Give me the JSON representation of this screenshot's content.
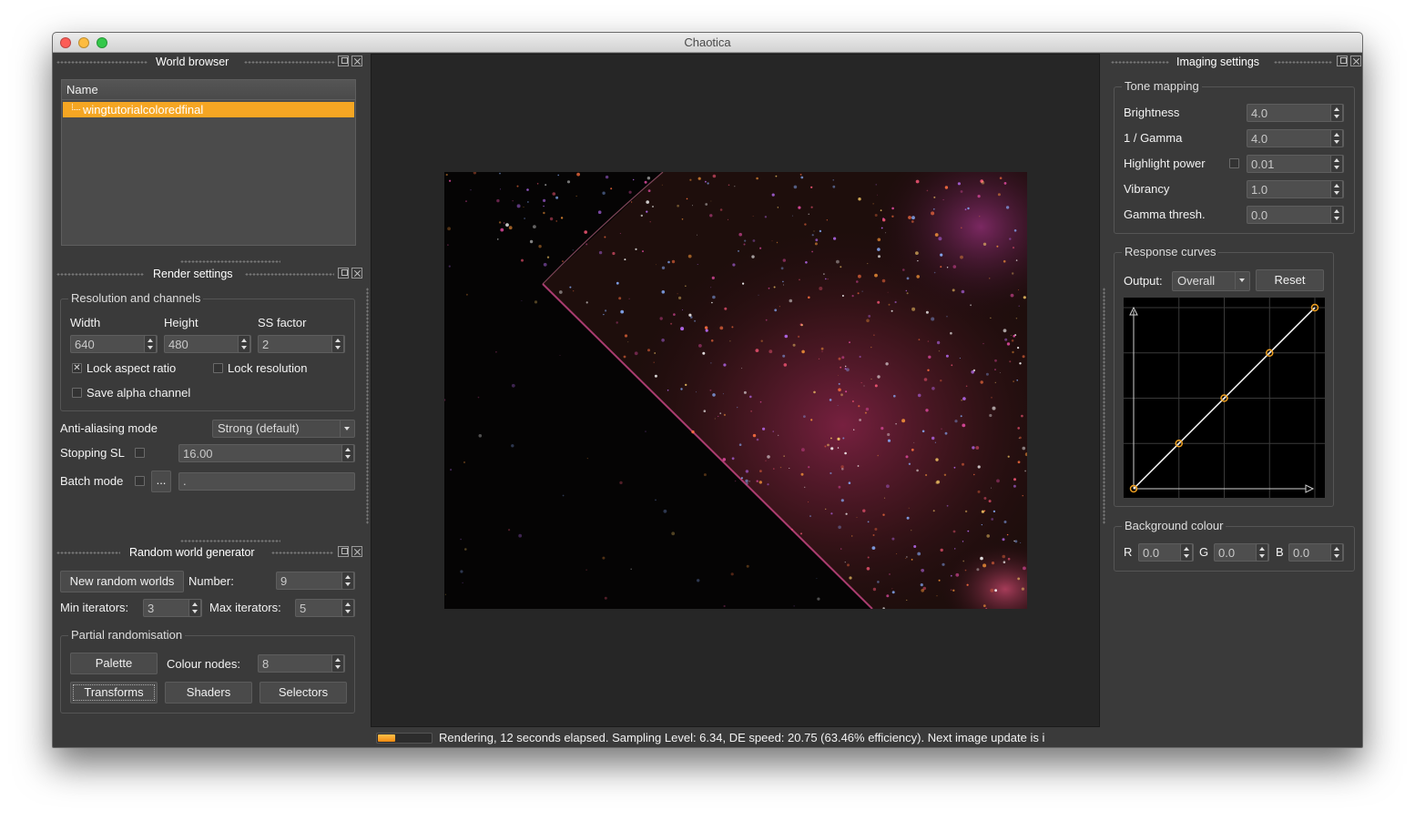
{
  "window": {
    "title": "Chaotica"
  },
  "world_browser": {
    "title": "World browser",
    "column_header": "Name",
    "items": [
      "wingtutorialcoloredfinal"
    ]
  },
  "render_settings": {
    "title": "Render settings",
    "group_title": "Resolution and channels",
    "width_label": "Width",
    "height_label": "Height",
    "ss_label": "SS factor",
    "width_value": "640",
    "height_value": "480",
    "ss_value": "2",
    "lock_aspect_label": "Lock aspect ratio",
    "lock_aspect_checked": true,
    "lock_resolution_label": "Lock resolution",
    "lock_resolution_checked": false,
    "save_alpha_label": "Save alpha channel",
    "save_alpha_checked": false,
    "aa_label": "Anti-aliasing mode",
    "aa_value": "Strong (default)",
    "stopping_label": "Stopping SL",
    "stopping_checked": false,
    "stopping_value": "16.00",
    "batch_label": "Batch mode",
    "batch_checked": false,
    "batch_button": "...",
    "batch_path": "."
  },
  "random_generator": {
    "title": "Random world generator",
    "new_button": "New random worlds",
    "number_label": "Number:",
    "number_value": "9",
    "min_label": "Min iterators:",
    "min_value": "3",
    "max_label": "Max iterators:",
    "max_value": "5",
    "partial_title": "Partial randomisation",
    "palette_button": "Palette",
    "colour_nodes_label": "Colour nodes:",
    "colour_nodes_value": "8",
    "transforms_button": "Transforms",
    "shaders_button": "Shaders",
    "selectors_button": "Selectors"
  },
  "imaging": {
    "title": "Imaging settings",
    "tone_title": "Tone mapping",
    "brightness_label": "Brightness",
    "brightness_value": "4.0",
    "gamma_label": "1 / Gamma",
    "gamma_value": "4.0",
    "highlight_label": "Highlight power",
    "highlight_checked": false,
    "highlight_value": "0.01",
    "vibrancy_label": "Vibrancy",
    "vibrancy_value": "1.0",
    "gamma_thresh_label": "Gamma thresh.",
    "gamma_thresh_value": "0.0",
    "curves_title": "Response curves",
    "output_label": "Output:",
    "output_value": "Overall",
    "reset_button": "Reset",
    "curve_points": [
      [
        0,
        0
      ],
      [
        0.25,
        0.25
      ],
      [
        0.5,
        0.5
      ],
      [
        0.75,
        0.75
      ],
      [
        1,
        1
      ]
    ],
    "bg_title": "Background colour",
    "r_label": "R",
    "r_value": "0.0",
    "g_label": "G",
    "g_value": "0.0",
    "b_label": "B",
    "b_value": "0.0"
  },
  "status": {
    "progress": 0.33,
    "text": "Rendering, 12 seconds elapsed. Sampling Level: 6.34, DE speed: 20.75 (63.46% efficiency). Next image update is i"
  },
  "colors": {
    "accent": "#f0a020",
    "selection": "#f5a623",
    "panel": "#3a3a3a",
    "viewport": "#272727"
  }
}
